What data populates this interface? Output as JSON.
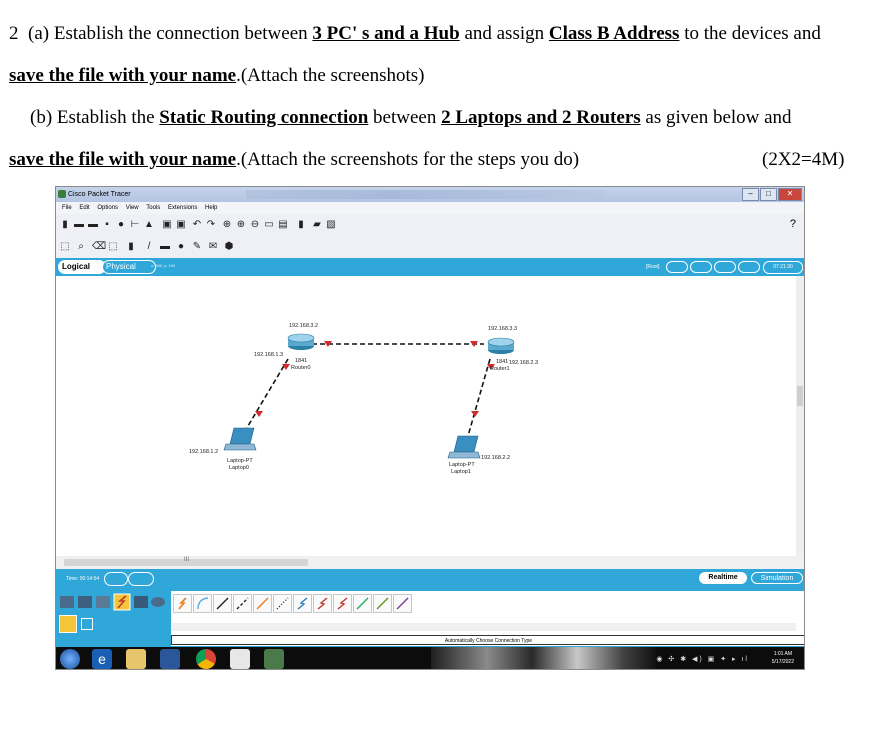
{
  "question": {
    "number": "2",
    "part_a": {
      "label": "(a)",
      "t1": "Establish the connection between ",
      "b1": "3 PC' s and a Hub",
      "t2": " and assign ",
      "b2": "Class B Address",
      "t3": " to the  devices and",
      "b3": "save the file with your name",
      "t4": ".(Attach the screenshots)"
    },
    "part_b": {
      "label": "(b)",
      "t1": "Establish the ",
      "b1": "Static Routing connection",
      "t2": " between ",
      "b2": "2 Laptops and 2 Routers",
      "t3": "  as given below and",
      "b3": "save the file with your name",
      "t4": ".(Attach the screenshots for the steps you do)",
      "marks": "(2X2=4M)"
    }
  },
  "app": {
    "title": "Cisco Packet Tracer",
    "menu": [
      "File",
      "Edit",
      "Options",
      "View",
      "Tools",
      "Extensions",
      "Help"
    ],
    "help_icon": "?",
    "tabs": {
      "logical": "Logical",
      "physical": "Physical"
    },
    "coords": "x: 666, y: 190",
    "root_label": "[Root]",
    "clock": "07:21:30",
    "time": "Time: 00:14:54",
    "realtime": "Realtime",
    "simulation": "Simulation",
    "connection_type": "Automatically Choose Connection Type",
    "h_scroll_mark": "III",
    "taskbar_time": "1:01 AM",
    "taskbar_date": "5/17/2022"
  },
  "topology": {
    "router0": {
      "ip_top": "192.168.3.2",
      "ip_left": "192.168.1.3",
      "model": "1841",
      "name": "Router0"
    },
    "router1": {
      "ip_top": "192.168.3.3",
      "ip_right": "192.168.2.3",
      "model": "1841",
      "name": "Router1"
    },
    "laptop0": {
      "ip": "192.168.1.2",
      "model": "Laptop-PT",
      "name": "Laptop0"
    },
    "laptop1": {
      "ip": "192.168.2.2",
      "model": "Laptop-PT",
      "name": "Laptop1"
    }
  }
}
